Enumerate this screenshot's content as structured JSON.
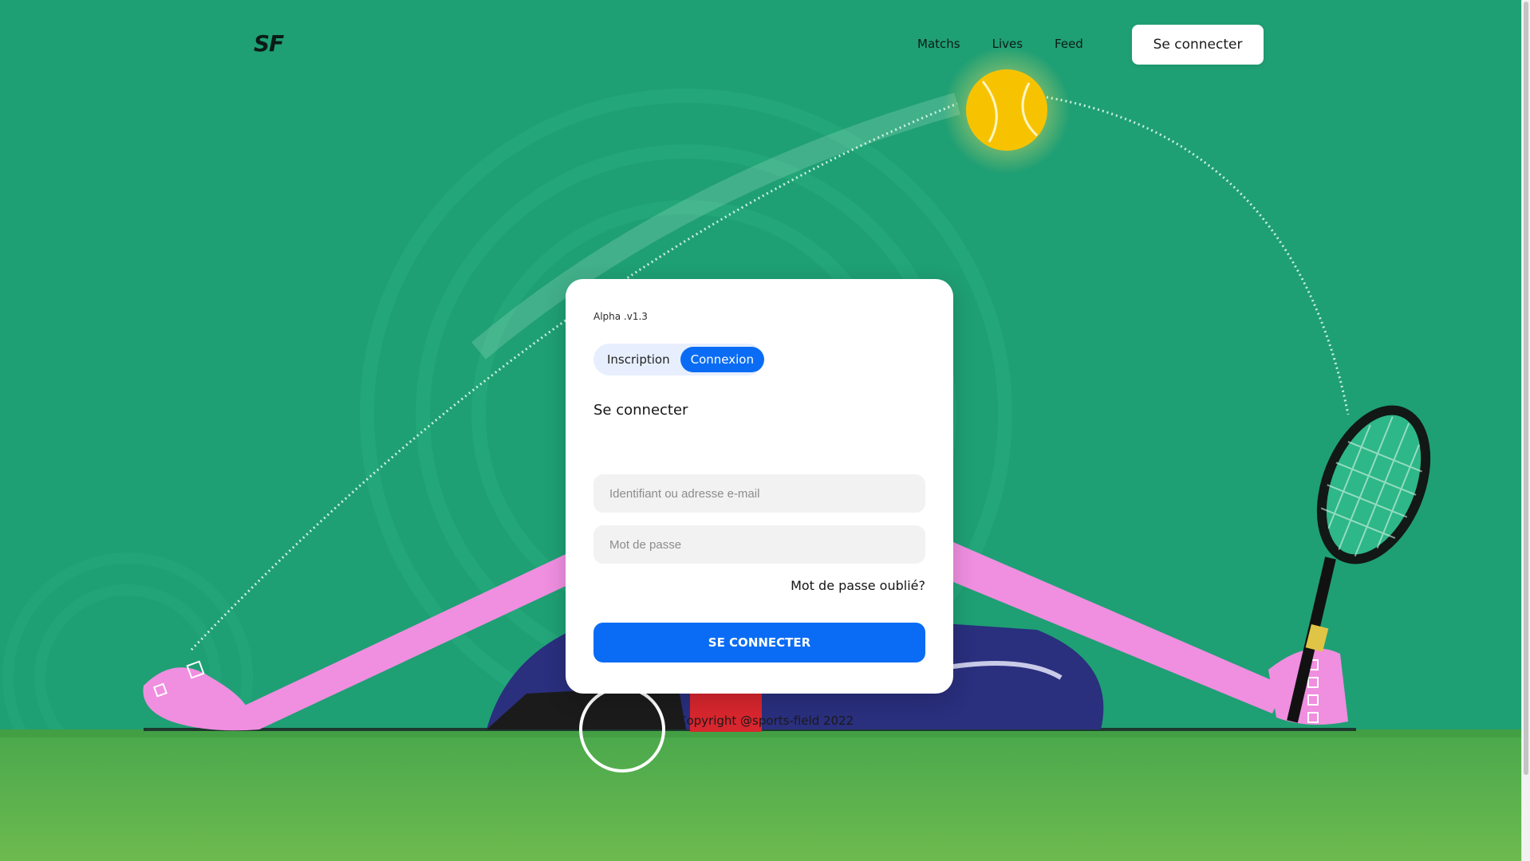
{
  "nav": {
    "logo": "SF",
    "links": [
      "Matchs",
      "Lives",
      "Feed"
    ],
    "login_button": "Se connecter"
  },
  "card": {
    "version": "Alpha .v1.3",
    "tabs": [
      {
        "label": "Inscription",
        "active": false
      },
      {
        "label": "Connexion",
        "active": true
      }
    ],
    "title": "Se connecter",
    "username_placeholder": "Identifiant ou adresse e-mail",
    "password_placeholder": "Mot de passe",
    "forgot_link": "Mot de passe oublié?",
    "submit_label": "SE CONNECTER"
  },
  "footer": {
    "copyright": "Copyright @sports-field 2022"
  },
  "colors": {
    "background": "#1f9f74",
    "primary": "#0a6cf5",
    "ball": "#f7c300",
    "limbs": "#f08ee0",
    "grass": "#5fb244"
  }
}
